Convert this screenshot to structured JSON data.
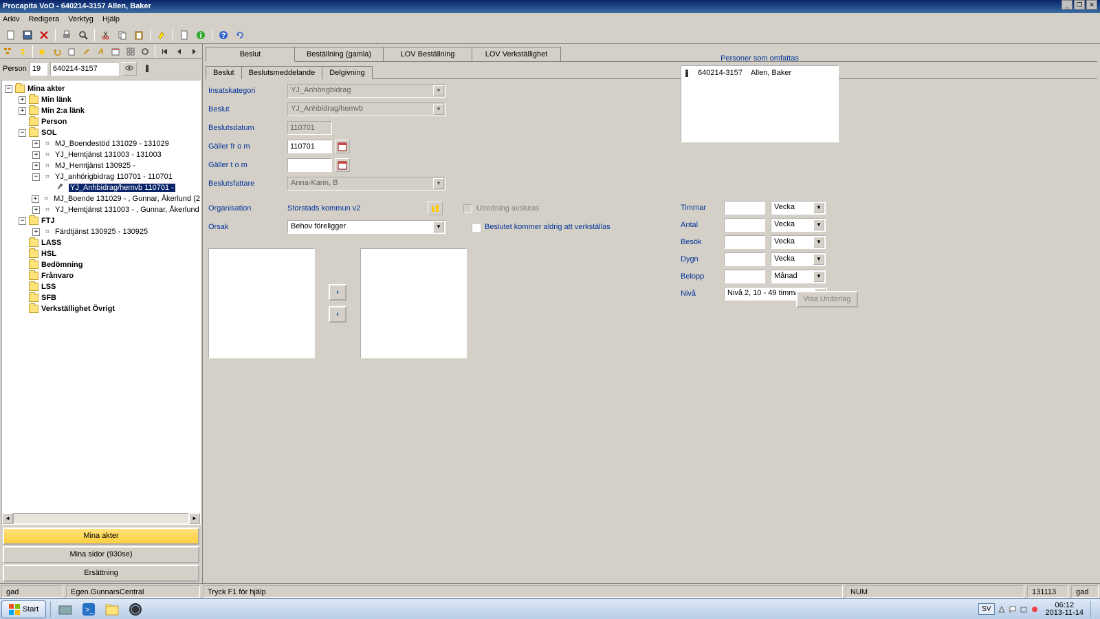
{
  "title": "Procapita VoO - 640214-3157 Allen, Baker",
  "menubar": {
    "items": [
      "Arkiv",
      "Redigera",
      "Verktyg",
      "Hjälp"
    ]
  },
  "person_section": {
    "label": "Person",
    "num": "19",
    "id": "640214-3157"
  },
  "tree": {
    "root": "Mina akter",
    "node1": "Min länk",
    "node2": "Min 2:a länk",
    "node3": "Person",
    "node4": "SOL",
    "n4_1": "MJ_Boendestöd 131029 - 131029",
    "n4_2": "YJ_Hemtjänst 131003 - 131003",
    "n4_3": "MJ_Hemtjänst 130925 -",
    "n4_4": "YJ_anhörigbidrag 110701 - 110701",
    "n4_4_1": "YJ_Anhbidrag/hemvb 110701 -",
    "n4_5": "MJ_Boende 131029 - , Gunnar, Åkerlund (2",
    "n4_6": "YJ_Hemtjänst 131003 - , Gunnar, Åkerlund",
    "node5": "FTJ",
    "n5_1": "Färdtjänst 130925 - 130925",
    "node6": "LASS",
    "node7": "HSL",
    "node8": "Bedömning",
    "node9": "Frånvaro",
    "node10": "LSS",
    "node11": "SFB",
    "node12": "Verkställighet Övrigt"
  },
  "nav": {
    "b1": "Mina akter",
    "b2": "Mina sidor (930se)",
    "b3": "Ersättning"
  },
  "top_tabs": {
    "t1": "Beslut",
    "t2": "Beställning (gamla)",
    "t3": "LOV Beställning",
    "t4": "LOV Verkställighet"
  },
  "sub_tabs": {
    "s1": "Beslut",
    "s2": "Beslutsmeddelande",
    "s3": "Delgivning"
  },
  "form": {
    "l_insatskategori": "Insatskategori",
    "v_insatskategori": "YJ_Anhörigbidrag",
    "l_beslut": "Beslut",
    "v_beslut": "YJ_Anhbidrag/hemvb",
    "l_beslutsdatum": "Beslutsdatum",
    "v_beslutsdatum": "110701",
    "l_galler_from": "Gäller fr o m",
    "v_galler_from": "110701",
    "l_galler_tom": "Gäller t o m",
    "v_galler_tom": "",
    "l_beslutsfattare": "Beslutsfattare",
    "v_beslutsfattare": "Anna-Karin, B",
    "l_organisation": "Organisation",
    "v_organisation": "Storstads kommun v2",
    "l_orsak": "Orsak",
    "v_orsak": "Behov föreligger",
    "chk1": "Utredning avslutas",
    "chk2": "Beslutet kommer aldrig att verkställas"
  },
  "persons": {
    "title": "Personer som omfattas",
    "p_id": "640214-3157",
    "p_name": "Allen, Baker"
  },
  "amounts": {
    "l_timmar": "Timmar",
    "u_timmar": "Vecka",
    "l_antal": "Antal",
    "u_antal": "Vecka",
    "l_besok": "Besök",
    "u_besok": "Vecka",
    "l_dygn": "Dygn",
    "u_dygn": "Vecka",
    "l_belopp": "Belopp",
    "u_belopp": "Månad",
    "l_niva": "Nivå",
    "v_niva": "Nivå 2, 10 - 49 timmar"
  },
  "visa_btn": "Visa Underlag",
  "status": {
    "s1": "gad",
    "s2": "Egen.GunnarsCentral",
    "s3": "Tryck F1 för hjälp",
    "s4": "NUM",
    "s5": "131113",
    "s6": "gad"
  },
  "taskbar": {
    "start": "Start",
    "lang": "SV",
    "time": "06:12",
    "date": "2013-11-14"
  }
}
